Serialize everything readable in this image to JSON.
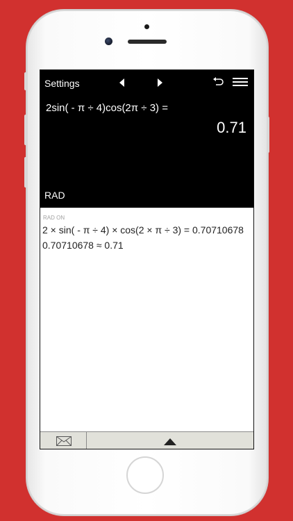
{
  "header": {
    "settings_label": "Settings",
    "nav_back_icon": "triangle-left-icon",
    "nav_forward_icon": "triangle-right-icon",
    "undo_icon": "undo-icon",
    "menu_icon": "hamburger-icon"
  },
  "display": {
    "expression": "2sin( - π ÷ 4)cos(2π ÷ 3) =",
    "result": "0.71",
    "angle_mode": "RAD"
  },
  "history": {
    "label": "RAD ON",
    "lines": [
      "2 × sin( - π ÷ 4) × cos(2 × π ÷ 3) = 0.70710678",
      "0.70710678 ≈ 0.71"
    ]
  },
  "bottom_bar": {
    "mail_icon": "envelope-icon",
    "expand_icon": "triangle-up-icon"
  },
  "colors": {
    "background": "#d1312f",
    "screen": "#000000",
    "history_bg": "#ffffff",
    "bottom_bar": "#e1e1da"
  }
}
